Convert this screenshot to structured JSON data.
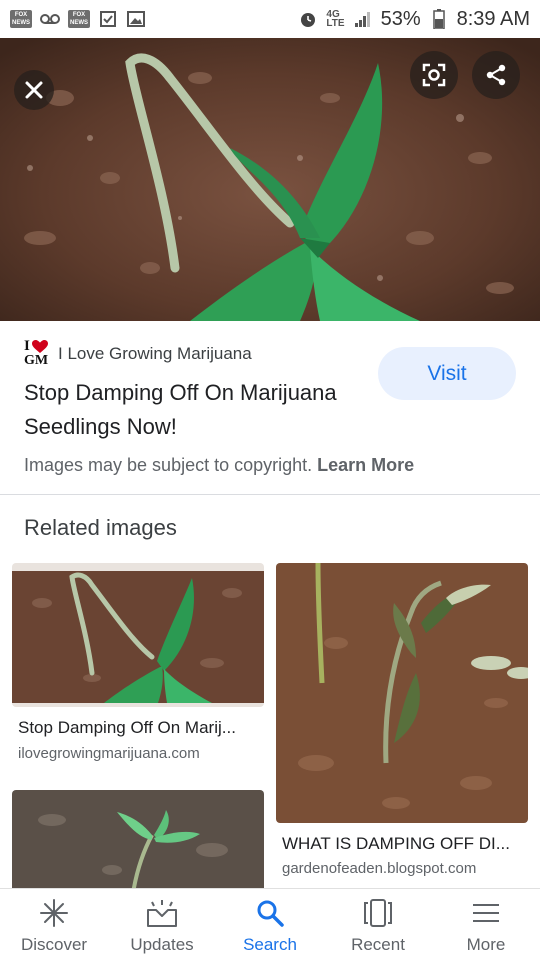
{
  "status_bar": {
    "battery": "53%",
    "time": "8:39 AM",
    "network_badge_top": "4G",
    "network_badge_bottom": "LTE",
    "fox_label_top": "FOX",
    "fox_label_bottom": "NEWS"
  },
  "hero": {
    "close_icon": "close-icon",
    "lens_icon": "lens-icon",
    "share_icon": "share-icon"
  },
  "result": {
    "source_logo_top": "I",
    "source_logo_bottom": "GM",
    "source_name": "I Love Growing Marijuana",
    "title": "Stop Damping Off On Marijuana Seedlings Now!",
    "visit_label": "Visit",
    "copyright_text": "Images may be subject to copyright.",
    "learn_more": "Learn More"
  },
  "related": {
    "heading": "Related images",
    "items": [
      {
        "caption": "Stop Damping Off On Marij...",
        "domain": "ilovegrowingmarijuana.com"
      },
      {
        "caption": "WHAT IS DAMPING OFF DI...",
        "domain": "gardenofeaden.blogspot.com"
      }
    ]
  },
  "bottom_nav": {
    "items": [
      {
        "label": "Discover",
        "icon": "asterisk-icon"
      },
      {
        "label": "Updates",
        "icon": "updates-tray-icon"
      },
      {
        "label": "Search",
        "icon": "search-icon"
      },
      {
        "label": "Recent",
        "icon": "recent-cards-icon"
      },
      {
        "label": "More",
        "icon": "menu-icon"
      }
    ],
    "active": "Search"
  },
  "colors": {
    "accent": "#1a73e8",
    "visit_bg": "#e8f0fe",
    "soil": "#6b4634",
    "leaf": "#2f9f55"
  }
}
